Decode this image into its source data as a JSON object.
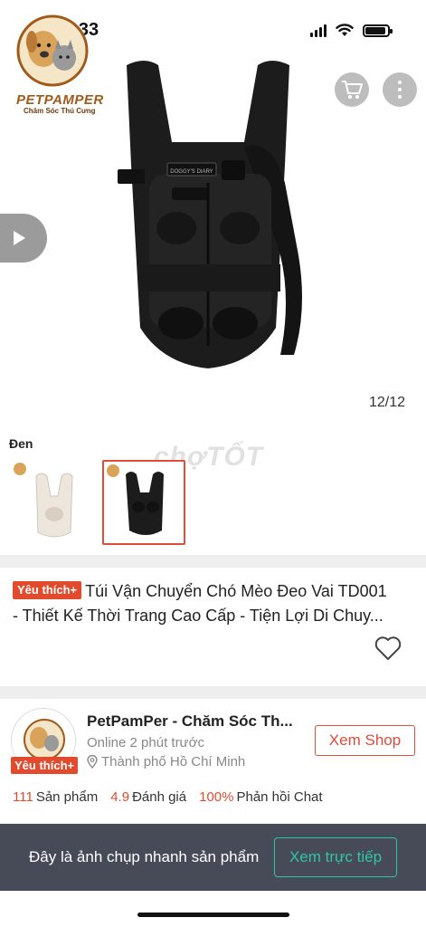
{
  "status": {
    "time": "22:33"
  },
  "logo": {
    "name": "PETPAMPER",
    "tagline": "Chăm Sóc Thú Cưng"
  },
  "gallery": {
    "counter": "12/12",
    "variant_label": "Đen",
    "watermark": "chợTỐT",
    "backpack_tag": "DOGGY'S DIARY"
  },
  "product": {
    "badge": "Yêu thích+",
    "title_line1": "Túi Vận Chuyển Chó Mèo Đeo Vai TD001",
    "title_line2": "- Thiết Kế Thời Trang Cao Cấp - Tiện Lợi Di Chuy..."
  },
  "shop": {
    "name": "PetPamPer - Chăm Sóc Th...",
    "status": "Online 2 phút trước",
    "location": "Thành phố Hồ Chí Minh",
    "badge": "Yêu thích+",
    "view_button": "Xem Shop",
    "stats": [
      {
        "value": "111",
        "label": "Sản phẩm"
      },
      {
        "value": "4.9",
        "label": "Đánh giá"
      },
      {
        "value": "100%",
        "label": "Phản hồi Chat"
      }
    ]
  },
  "snapshot": {
    "text": "Đây là ảnh chụp nhanh sản phẩm",
    "button": "Xem trực tiếp"
  },
  "colors": {
    "accent": "#e24a2e",
    "live": "#2ec4a5",
    "bar": "#474b57"
  }
}
